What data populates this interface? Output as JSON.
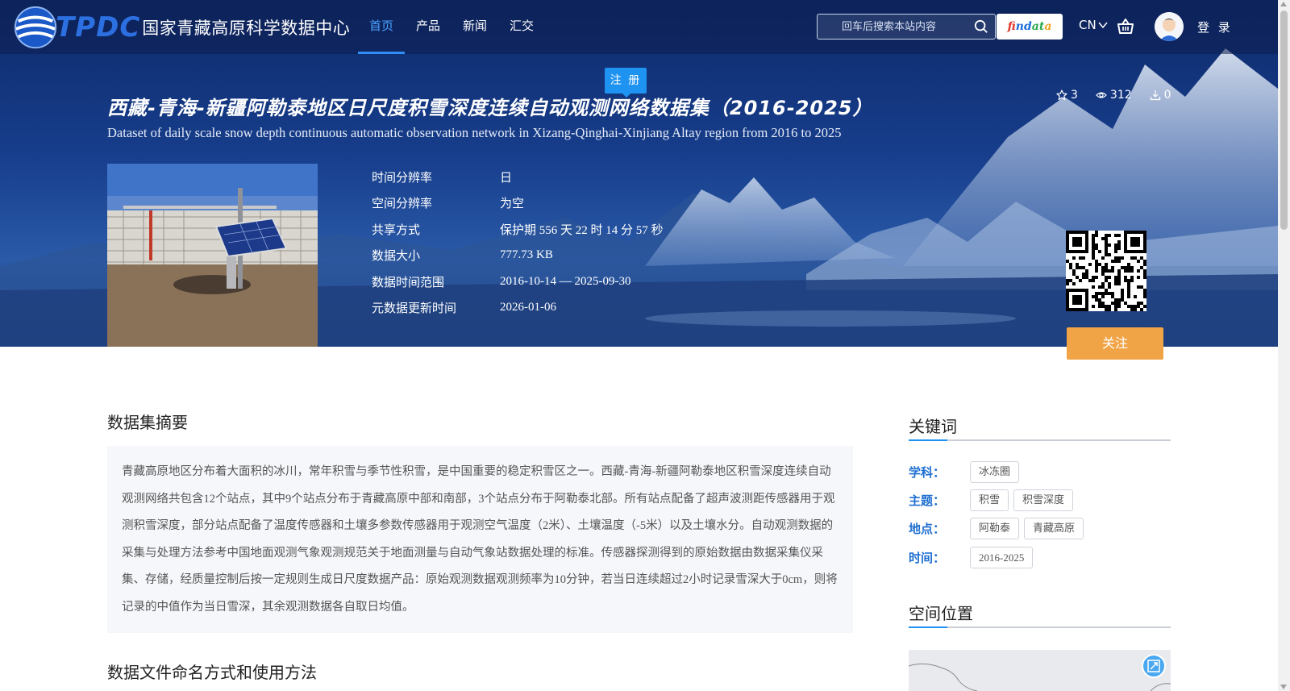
{
  "header": {
    "logo_abbr": "TPDC",
    "logo_name": "国家青藏高原科学数据中心",
    "nav": [
      {
        "label": "首页",
        "active": true
      },
      {
        "label": "产品",
        "active": false
      },
      {
        "label": "新闻",
        "active": false
      },
      {
        "label": "汇交",
        "active": false
      }
    ],
    "search_placeholder": "回车后搜索本站内容",
    "findata": {
      "p1": "fi",
      "p2": "nd",
      "p3": "at",
      "p4": "a"
    },
    "lang": "CN",
    "login_label": "登 录",
    "register_label": "注 册"
  },
  "dataset": {
    "title_cn": "西藏-青海-新疆阿勒泰地区日尺度积雪深度连续自动观测网络数据集（2016-2025）",
    "title_en": "Dataset of daily scale snow depth continuous automatic observation network in Xizang-Qinghai-Xinjiang Altay region from 2016 to 2025",
    "stats": {
      "stars": "3",
      "views": "312",
      "downloads": "0"
    },
    "meta": [
      {
        "label": "时间分辨率",
        "value": "日"
      },
      {
        "label": "空间分辨率",
        "value": "为空"
      },
      {
        "label": "共享方式",
        "value": "保护期 556 天 22 时 14 分 57 秒"
      },
      {
        "label": "数据大小",
        "value": "777.73 KB"
      },
      {
        "label": "数据时间范围",
        "value": "2016-10-14 — 2025-09-30"
      },
      {
        "label": "元数据更新时间",
        "value": "2026-01-06"
      }
    ],
    "follow_label": "关注"
  },
  "main": {
    "abstract_title": "数据集摘要",
    "abstract_text": "青藏高原地区分布着大面积的冰川，常年积雪与季节性积雪，是中国重要的稳定积雪区之一。西藏-青海-新疆阿勒泰地区积雪深度连续自动观测网络共包含12个站点，其中9个站点分布于青藏高原中部和南部，3个站点分布于阿勒泰北部。所有站点配备了超声波测距传感器用于观测积雪深度，部分站点配备了温度传感器和土壤多参数传感器用于观测空气温度（2米）、土壤温度（-5米）以及土壤水分。自动观测数据的采集与处理方法参考中国地面观测气象观测规范关于地面测量与自动气象站数据处理的标准。传感器探测得到的原始数据由数据采集仪采集、存储，经质量控制后按一定规则生成日尺度数据产品：原始观测数据观测频率为10分钟，若当日连续超过2小时记录雪深大于0cm，则将记录的中值作为当日雪深，其余观测数据各自取日均值。",
    "naming_title": "数据文件命名方式和使用方法"
  },
  "sidebar": {
    "keywords_title": "关键词",
    "keywords": [
      {
        "label": "学科：",
        "tags": [
          "冰冻圈"
        ]
      },
      {
        "label": "主题：",
        "tags": [
          "积雪",
          "积雪深度"
        ]
      },
      {
        "label": "地点：",
        "tags": [
          "阿勒泰",
          "青藏高原"
        ]
      },
      {
        "label": "时间：",
        "tags": [
          "2016-2025"
        ]
      }
    ],
    "location_title": "空间位置"
  }
}
